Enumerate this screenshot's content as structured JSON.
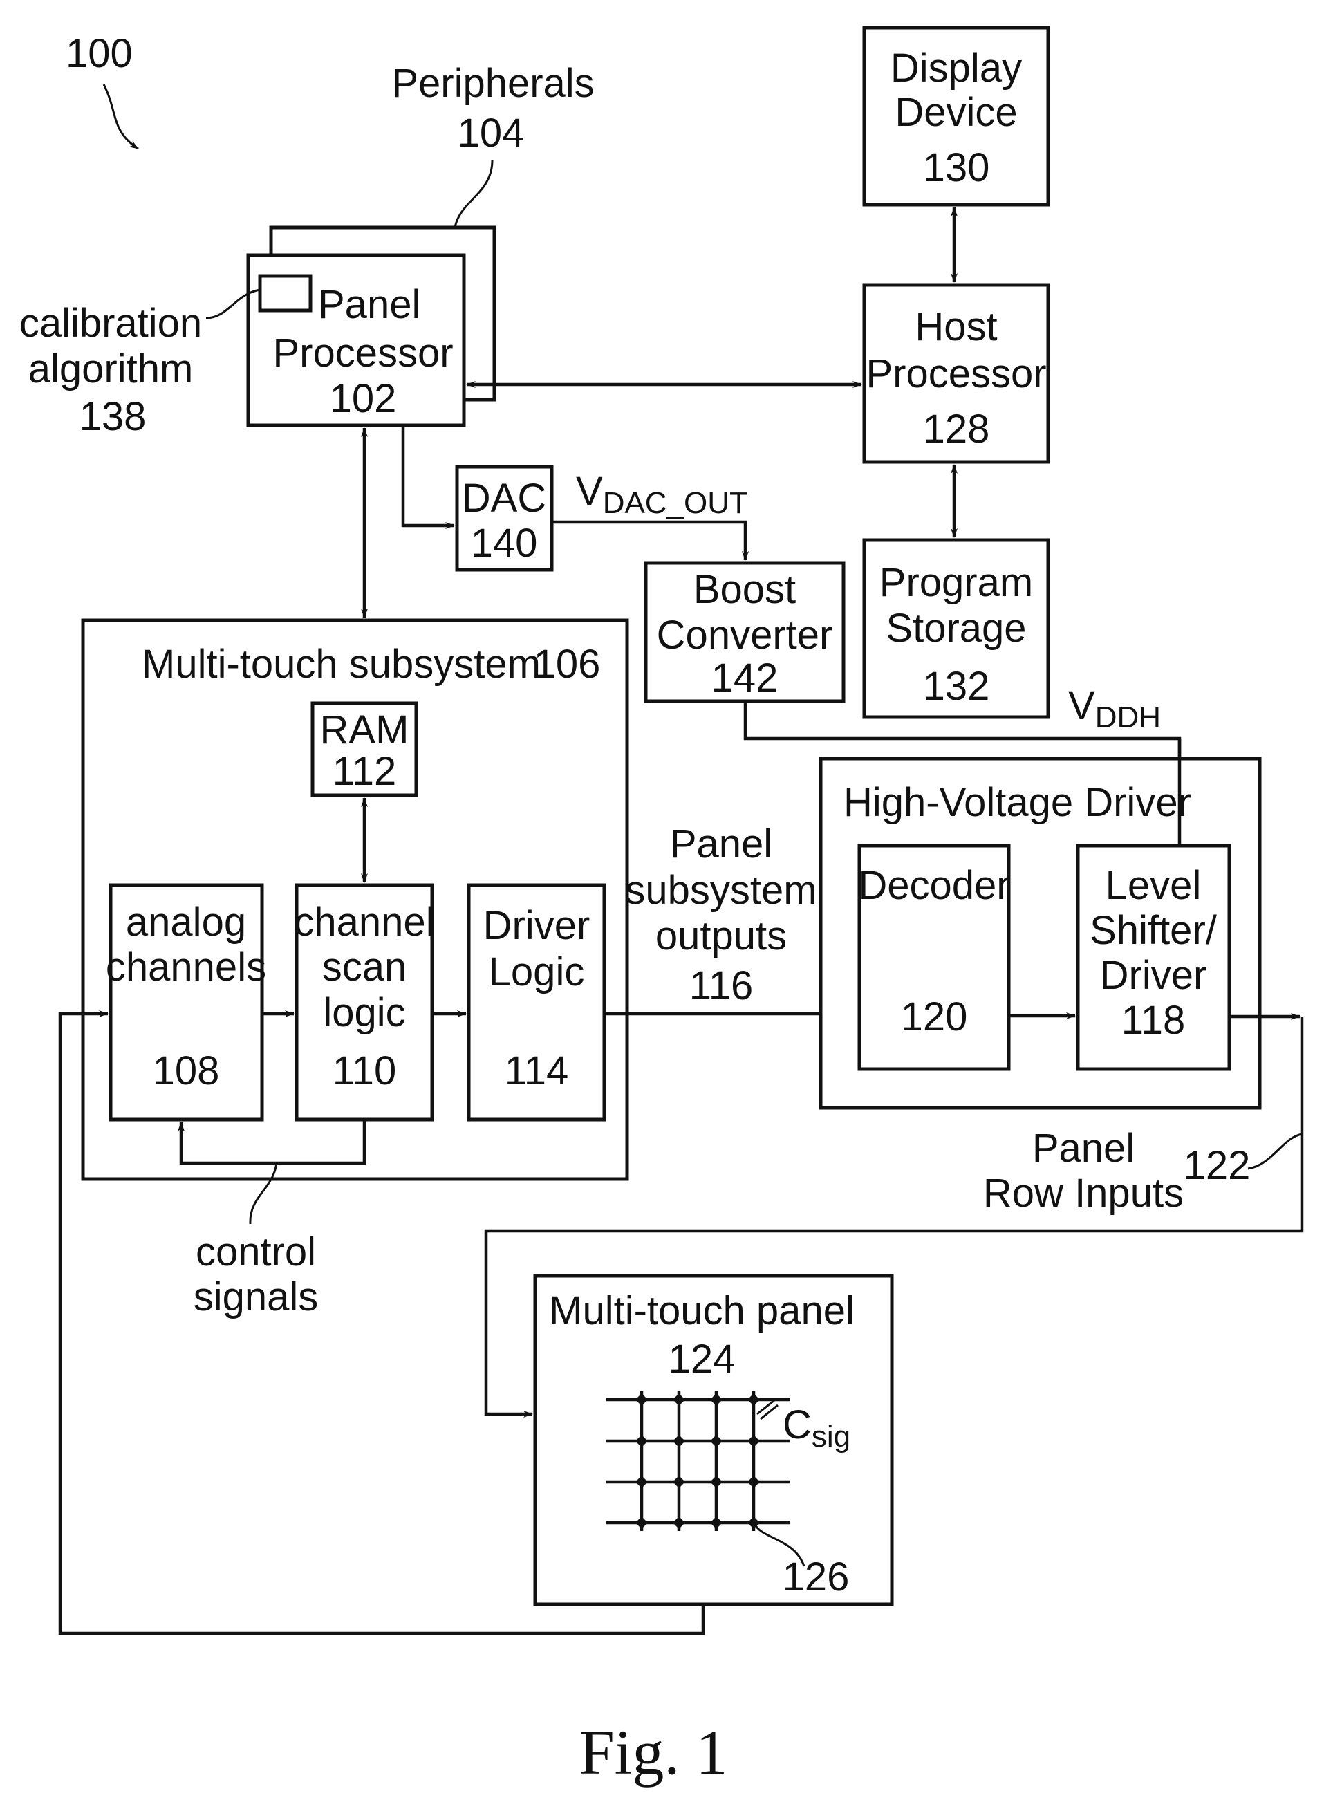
{
  "figure": {
    "caption": "Fig. 1",
    "ref": "100"
  },
  "blocks": {
    "peripherals": {
      "label": "Peripherals",
      "ref": "104"
    },
    "panel_processor": {
      "line1": "Panel",
      "line2": "Processor",
      "ref": "102"
    },
    "calibration": {
      "line1": "calibration",
      "line2": "algorithm",
      "ref": "138"
    },
    "display_device": {
      "line1": "Display",
      "line2": "Device",
      "ref": "130"
    },
    "host_processor": {
      "line1": "Host",
      "line2": "Processor",
      "ref": "128"
    },
    "program_storage": {
      "line1": "Program",
      "line2": "Storage",
      "ref": "132"
    },
    "dac": {
      "label": "DAC",
      "ref": "140"
    },
    "boost_converter": {
      "line1": "Boost",
      "line2": "Converter",
      "ref": "142"
    },
    "multitouch_subsystem": {
      "label": "Multi-touch subsystem",
      "ref": "106"
    },
    "ram": {
      "label": "RAM",
      "ref": "112"
    },
    "analog_channels": {
      "line1": "analog",
      "line2": "channels",
      "ref": "108"
    },
    "channel_scan_logic": {
      "line1": "channel",
      "line2": "scan",
      "line3": "logic",
      "ref": "110"
    },
    "driver_logic": {
      "line1": "Driver",
      "line2": "Logic",
      "ref": "114"
    },
    "high_voltage_driver": {
      "label": "High-Voltage Driver"
    },
    "decoder": {
      "label": "Decoder",
      "ref": "120"
    },
    "level_shifter": {
      "line1": "Level",
      "line2": "Shifter/",
      "line3": "Driver",
      "ref": "118"
    },
    "multitouch_panel": {
      "label": "Multi-touch panel",
      "ref": "124",
      "node_ref": "126",
      "cap_main": "C",
      "cap_sub": "sig"
    }
  },
  "signals": {
    "vdac_main": "V",
    "vdac_sub": "DAC_OUT",
    "vddh_main": "V",
    "vddh_sub": "DDH",
    "panel_outputs": {
      "line1": "Panel",
      "line2": "subsystem",
      "line3": "outputs",
      "ref": "116"
    },
    "panel_row_inputs": {
      "line1": "Panel",
      "line2": "Row Inputs",
      "ref": "122"
    },
    "control_signals": {
      "line1": "control",
      "line2": "signals"
    }
  }
}
